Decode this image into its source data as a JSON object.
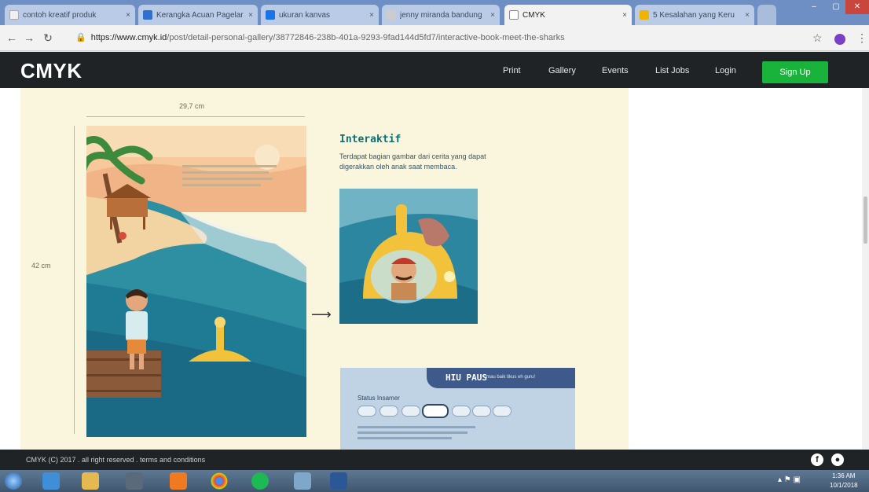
{
  "browser": {
    "tabs": [
      {
        "label": "contoh kreatif produk",
        "favicon_color": "#f0f0f0",
        "active": false
      },
      {
        "label": "Kerangka Acuan Pagelar",
        "favicon_color": "#2e6fd0",
        "active": false
      },
      {
        "label": "ukuran kanvas",
        "favicon_color": "#1a73e8",
        "active": false
      },
      {
        "label": "jenny miranda bandung",
        "favicon_color": "#cccccc",
        "active": false
      },
      {
        "label": "CMYK",
        "favicon_color": "#ffffff",
        "active": true
      },
      {
        "label": "5 Kesalahan yang Keru",
        "favicon_color": "#f0b400",
        "active": false
      }
    ],
    "url_host": "https://www.cmyk.id",
    "url_path": "/post/detail-personal-gallery/38772846-238b-401a-9293-9fad144d5fd7/interactive-book-meet-the-sharks"
  },
  "site": {
    "logo": "CMYK",
    "nav": [
      "Print",
      "Gallery",
      "Events",
      "List Jobs",
      "Login"
    ],
    "signup": "Sign Up"
  },
  "poster": {
    "width_label": "29,7 cm",
    "height_label": "42 cm",
    "feature_title": "Interaktif",
    "feature_desc": "Terdapat bagian gambar dari cerita yang dapat digerakkan oleh anak saat membaca.",
    "panel_title": "HIU PAUS",
    "panel_subtitle": "mau baik tikus eh guru!",
    "panel_label": "Status Insamer"
  },
  "footer": {
    "text": "CMYK (C) 2017 . all right reserved . terms and conditions"
  },
  "taskbar": {
    "time": "1:36 AM",
    "date": "10/1/2018"
  },
  "colors": {
    "header_bg": "#1f2326",
    "signup_bg": "#19b33b",
    "poster_bg": "#faf6de",
    "accent_teal": "#0e6f74"
  }
}
